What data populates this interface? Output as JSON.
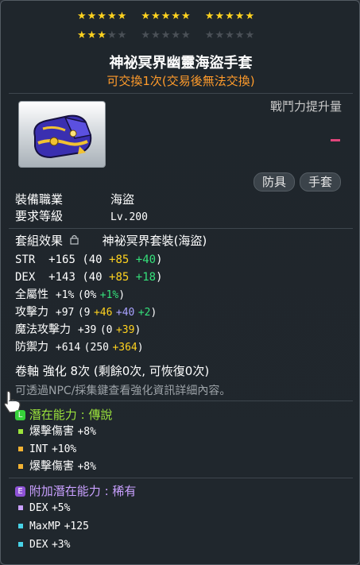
{
  "stars": {
    "row1": [
      "★★★★★",
      "★★★★★",
      "★★★★★"
    ],
    "row2_on": "★★★",
    "row2_off_a": "★★",
    "row2_off_b": "★★★★★",
    "row2_off_c": "★★★★★",
    "filled": 18,
    "total": 25
  },
  "item": {
    "name": "神祕冥界幽靈海盜手套",
    "trade_note": "可交換1次(交易後無法交換)",
    "icon": "pirate-glove-icon",
    "power_label": "戰鬥力提升量",
    "tags": [
      "防具",
      "手套"
    ]
  },
  "requirements": {
    "job_label": "裝備職業",
    "job_value": "海盜",
    "level_label": "要求等級",
    "level_value": "Lv.200"
  },
  "set": {
    "label": "套組效果",
    "lock_icon": "lock-icon",
    "value": "神祕冥界套裝(海盜)"
  },
  "stats": [
    {
      "name": "STR",
      "total": "+165",
      "base": "(40",
      "bonus1": "+85",
      "bonus2": "+40",
      "close": ")"
    },
    {
      "name": "DEX",
      "total": "+143",
      "base": "(40",
      "bonus1": "+85",
      "bonus2": "+18",
      "close": ")"
    },
    {
      "name": "全屬性",
      "total": "+1%",
      "base": "(0%",
      "bonus1": "+1%",
      "close": ")"
    },
    {
      "name": "攻擊力",
      "total": "+97",
      "base": "(9",
      "bonus1": "+46",
      "bonus2": "+40",
      "bonus3": "+2",
      "close": ")"
    },
    {
      "name": "魔法攻擊力",
      "total": "+39",
      "base": "(0",
      "bonus1": "+39",
      "close": ")"
    },
    {
      "name": "防禦力",
      "total": "+614",
      "base": "(250",
      "bonus1": "+364",
      "close": ")"
    }
  ],
  "scroll": "卷軸 強化 8次 (剩餘0次, 可恢復0次)",
  "hint": "可透過NPC/採集鍵查看強化資訊詳細內容。",
  "potential": {
    "badge": "L",
    "label": "潛在能力",
    "sep": ":",
    "grade": "傳說",
    "lines": [
      {
        "name": "爆擊傷害",
        "value": "+8%"
      },
      {
        "name": "INT",
        "value": "+10%"
      },
      {
        "name": "爆擊傷害",
        "value": "+8%"
      }
    ]
  },
  "additional": {
    "badge": "E",
    "label": "附加潛在能力",
    "sep": ":",
    "grade": "稀有",
    "lines": [
      {
        "name": "DEX",
        "value": "+5%"
      },
      {
        "name": "MaxMP",
        "value": "+125"
      },
      {
        "name": "DEX",
        "value": "+3%"
      }
    ]
  },
  "colors": {
    "star": "#ffd21f",
    "trade_note": "#ff9b2b",
    "legendary": "#36d13a",
    "rare": "#8e52d6",
    "bonus_yellow": "#ffd21f",
    "bonus_green": "#35e07a",
    "bonus_purple": "#a9a2ff"
  }
}
